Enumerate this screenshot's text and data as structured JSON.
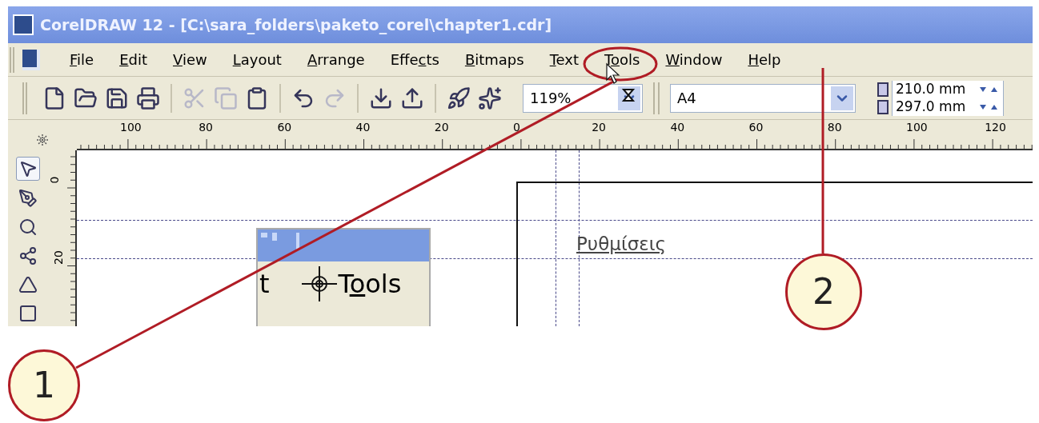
{
  "window": {
    "title": "CorelDRAW 12 - [C:\\sara_folders\\paketo_corel\\chapter1.cdr]"
  },
  "menu": [
    {
      "key": "F",
      "post": "ile"
    },
    {
      "key": "E",
      "post": "dit"
    },
    {
      "key": "V",
      "post": "iew"
    },
    {
      "key": "L",
      "post": "ayout"
    },
    {
      "key": "A",
      "post": "rrange"
    },
    {
      "pre": "Effe",
      "key": "c",
      "post": "ts"
    },
    {
      "key": "B",
      "post": "itmaps"
    },
    {
      "key": "T",
      "post": "ext"
    },
    {
      "pre": "T",
      "key": "o",
      "post": "ols"
    },
    {
      "key": "W",
      "post": "indow"
    },
    {
      "key": "H",
      "post": "elp"
    }
  ],
  "toolbar": {
    "zoom": "119%",
    "page_size": "A4",
    "width": "210.0 mm",
    "height": "297.0 mm"
  },
  "ruler_h": [
    "100",
    "80",
    "60",
    "40",
    "20",
    "0",
    "20",
    "40",
    "60",
    "80",
    "100",
    "120"
  ],
  "ruler_v": [
    "0",
    "20"
  ],
  "canvas": {
    "text": "Ρυθμίσεις",
    "inset": {
      "letter": "t",
      "menu": {
        "pre": "T",
        "key": "o",
        "post": "ols"
      }
    }
  },
  "callouts": [
    "1",
    "2"
  ]
}
